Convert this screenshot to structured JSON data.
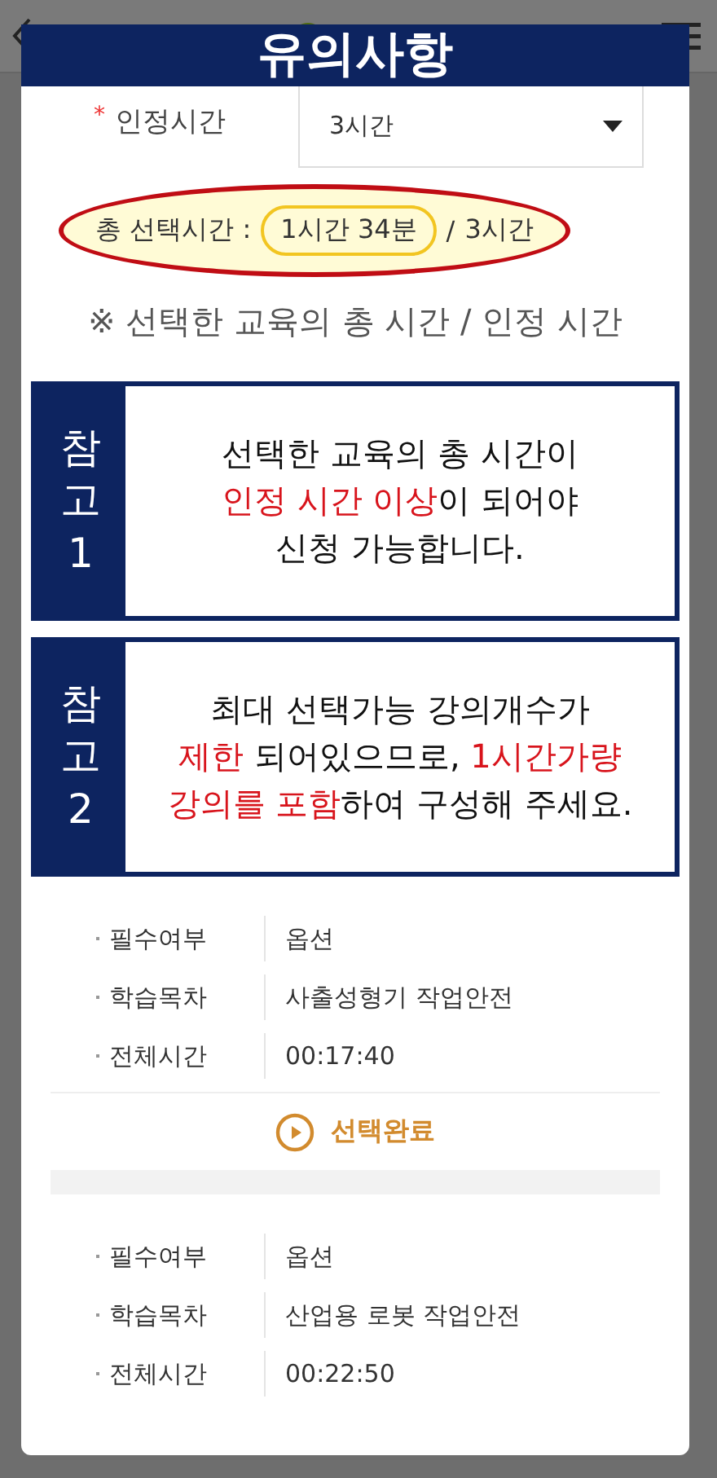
{
  "dialog": {
    "title": "유의사항"
  },
  "field": {
    "label": "인정시간",
    "required_mark": "*",
    "value": "3시간"
  },
  "summary": {
    "label": "총 선택시간 :",
    "selected_time": "1시간 34분",
    "separator": "/",
    "total": "3시간"
  },
  "note": "※ 선택한 교육의 총 시간 / 인정 시간",
  "notices": [
    {
      "tag": "참고1",
      "lines": [
        [
          {
            "text": "선택한 교육의 총 시간이",
            "highlight": false
          }
        ],
        [
          {
            "text": "인정 시간 이상",
            "highlight": true
          },
          {
            "text": "이 되어야",
            "highlight": false
          }
        ],
        [
          {
            "text": "신청 가능합니다.",
            "highlight": false
          }
        ]
      ]
    },
    {
      "tag": "참고2",
      "lines": [
        [
          {
            "text": "최대 선택가능 강의개수가",
            "highlight": false
          }
        ],
        [
          {
            "text": "제한",
            "highlight": true
          },
          {
            "text": " 되어있으므로, ",
            "highlight": false
          },
          {
            "text": "1시간가량",
            "highlight": true
          }
        ],
        [
          {
            "text": "강의를 포함",
            "highlight": true
          },
          {
            "text": "하여 구성해 주세요.",
            "highlight": false
          }
        ]
      ]
    }
  ],
  "courses": [
    {
      "rows": [
        {
          "label": "필수여부",
          "value": "옵션"
        },
        {
          "label": "학습목차",
          "value": "사출성형기 작업안전"
        },
        {
          "label": "전체시간",
          "value": "00:17:40"
        }
      ],
      "button": "선택완료"
    },
    {
      "rows": [
        {
          "label": "필수여부",
          "value": "옵션"
        },
        {
          "label": "학습목차",
          "value": "산업용 로봇 작업안전"
        },
        {
          "label": "전체시간",
          "value": "00:22:50"
        }
      ]
    }
  ]
}
